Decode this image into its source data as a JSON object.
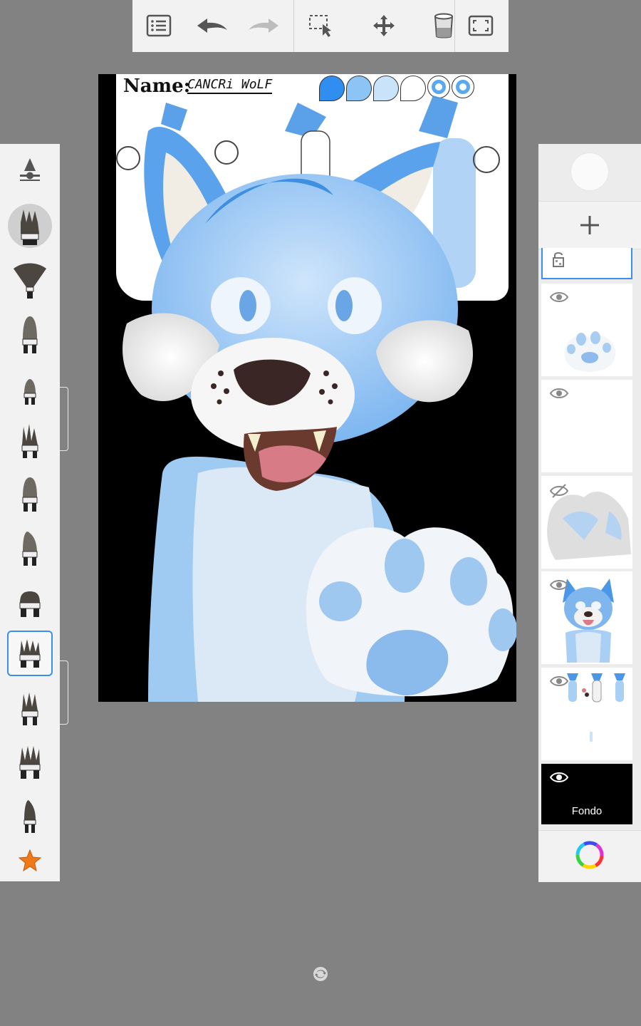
{
  "toolbar": {
    "items": [
      "list-menu",
      "undo",
      "redo",
      "selection",
      "transform",
      "fill-bucket",
      "fullscreen"
    ]
  },
  "canvas": {
    "ref_title": "Name:",
    "ref_name": "CANCRi WoLF",
    "palette_colors": [
      "#2f8ef0",
      "#8cc4f5",
      "#c9e3fb",
      "#ffffff"
    ]
  },
  "brushes": {
    "count": 12,
    "selected_index": 8,
    "favorite_icon": "star-icon",
    "accent": "#3c8ee8"
  },
  "layers": {
    "items": [
      {
        "name": "layer-locked",
        "visible": true,
        "locked": true
      },
      {
        "name": "layer-paw",
        "visible": true
      },
      {
        "name": "layer-empty",
        "visible": true
      },
      {
        "name": "layer-fur-hidden",
        "visible": false
      },
      {
        "name": "layer-wolf",
        "visible": true
      },
      {
        "name": "layer-reference",
        "visible": true
      },
      {
        "name": "layer-background",
        "visible": true,
        "label": "Fondo"
      }
    ]
  }
}
